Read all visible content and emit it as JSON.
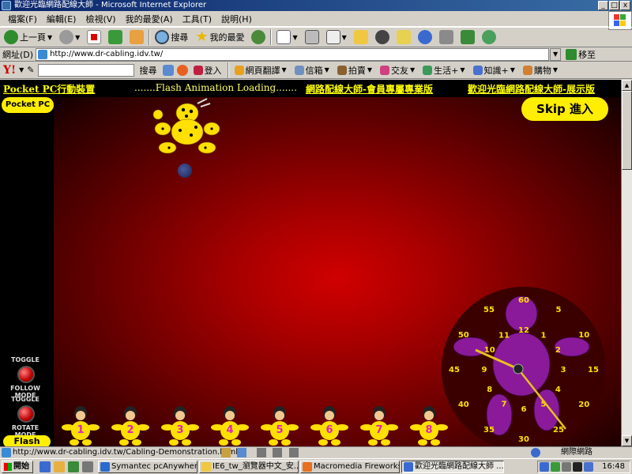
{
  "window": {
    "title": "歡迎光臨網路配線大師 - Microsoft Internet Explorer",
    "buttons": [
      "_",
      "□",
      "x"
    ]
  },
  "menu": [
    "檔案(F)",
    "編輯(E)",
    "檢視(V)",
    "我的最愛(A)",
    "工具(T)",
    "說明(H)"
  ],
  "toolbar": {
    "back": "上一頁",
    "search": "搜尋",
    "favorites": "我的最愛"
  },
  "address": {
    "label": "網址(D)",
    "url": "http://www.dr-cabling.idv.tw/",
    "go": "移至"
  },
  "yahoo": {
    "logo": "Y!",
    "search_button": "搜尋",
    "login": "登入",
    "items": [
      "網頁翻譯",
      "信箱",
      "拍賣",
      "交友",
      "生活+",
      "知識+",
      "購物"
    ]
  },
  "page": {
    "links": {
      "pocketpc": "Pocket PC行動裝置",
      "member": "網路配線大師-會員專屬專業版",
      "demo": "歡迎光臨網路配線大師-展示版"
    },
    "loading": ".......Flash Animation Loading.......",
    "pocketpc_button": "Pocket PC",
    "skip_button": "Skip 進入",
    "toggle_follow": [
      "TOGGLE",
      "FOLLOW MODE"
    ],
    "toggle_rotate": [
      "TOGGLE",
      "ROTATE MODE"
    ],
    "flash_button": "Flash",
    "clock_numbers": {
      "outer": [
        "60",
        "5",
        "10",
        "15",
        "20",
        "25",
        "30",
        "35",
        "40",
        "45",
        "50",
        "55"
      ],
      "inner": [
        "12",
        "1",
        "2",
        "3",
        "4",
        "5",
        "6",
        "7",
        "8",
        "9",
        "10",
        "11"
      ]
    },
    "dolls": [
      "1",
      "2",
      "3",
      "4",
      "5",
      "6",
      "7",
      "8"
    ]
  },
  "status": {
    "text": "http://www.dr-cabling.idv.tw/Cabling-Demonstration.html",
    "zone": "網際網路"
  },
  "taskbar": {
    "start": "開始",
    "tasks": [
      "Symantec pcAnywhere",
      "IE6_tw_瀏覽器中文_安...",
      "Macromedia Fireworks M...",
      "歡迎光臨網路配線大師 ..."
    ],
    "time": "16:48"
  },
  "colors": {
    "link_yellow": "#ffff00",
    "button_yellow": "#ffee00",
    "stage_red": "#d00000",
    "title_blue": "#0a246a"
  }
}
